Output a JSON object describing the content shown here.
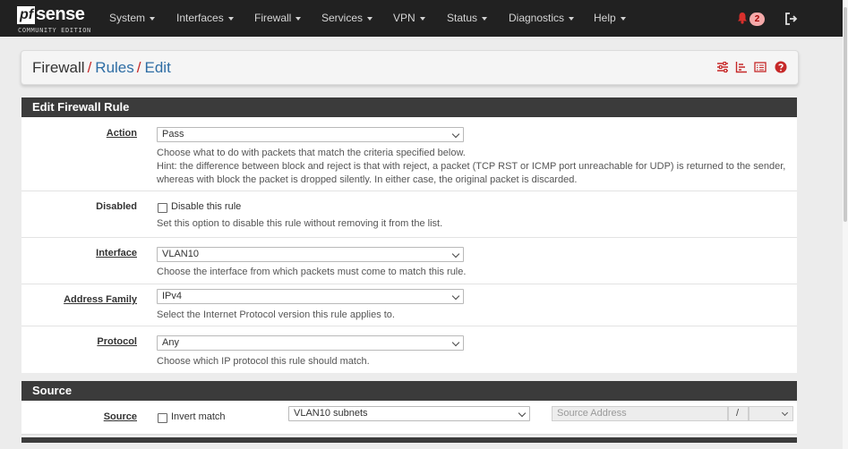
{
  "brand": {
    "name_pf": "pf",
    "name_sense": "sense",
    "edition": "COMMUNITY EDITION"
  },
  "nav": {
    "items": [
      "System",
      "Interfaces",
      "Firewall",
      "Services",
      "VPN",
      "Status",
      "Diagnostics",
      "Help"
    ],
    "notification_count": "2"
  },
  "breadcrumb": {
    "root": "Firewall",
    "rules": "Rules",
    "current": "Edit",
    "separator": "/"
  },
  "edit_panel": {
    "title": "Edit Firewall Rule",
    "action": {
      "label": "Action",
      "value": "Pass",
      "help1": "Choose what to do with packets that match the criteria specified below.",
      "help2": "Hint: the difference between block and reject is that with reject, a packet (TCP RST or ICMP port unreachable for UDP) is returned to the sender,",
      "help3": "whereas with block the packet is dropped silently. In either case, the original packet is discarded."
    },
    "disabled": {
      "label": "Disabled",
      "checkbox_label": "Disable this rule",
      "help": "Set this option to disable this rule without removing it from the list."
    },
    "interface": {
      "label": "Interface",
      "value": "VLAN10",
      "help": "Choose the interface from which packets must come to match this rule."
    },
    "address_family": {
      "label": "Address Family",
      "value": "IPv4",
      "help": "Select the Internet Protocol version this rule applies to."
    },
    "protocol": {
      "label": "Protocol",
      "value": "Any",
      "help": "Choose which IP protocol this rule should match."
    }
  },
  "source_panel": {
    "title": "Source",
    "label": "Source",
    "invert_label": "Invert match",
    "type_value": "VLAN10 subnets",
    "address_placeholder": "Source Address",
    "mask_separator": "/"
  },
  "colors": {
    "navbar": "#212121",
    "panel_header": "#3b3b3b",
    "link": "#2e6da4",
    "alert": "#d9302c"
  }
}
